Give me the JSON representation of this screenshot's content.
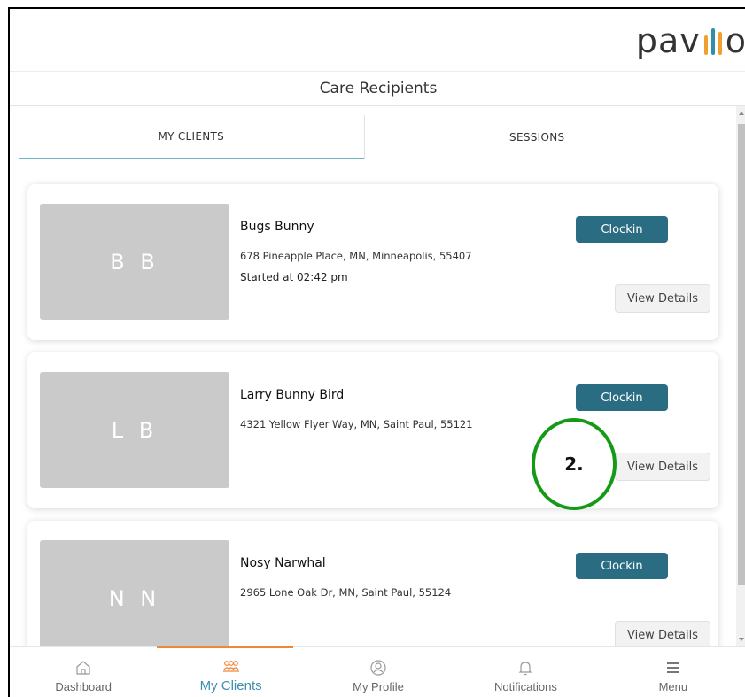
{
  "app": {
    "logo_text_left": "pav",
    "logo_text_right": "o"
  },
  "header": {
    "title": "Care Recipients"
  },
  "tabs": [
    {
      "label": "MY CLIENTS",
      "active": true
    },
    {
      "label": "SESSIONS",
      "active": false
    }
  ],
  "clients": [
    {
      "initials": "B B",
      "name": "Bugs Bunny",
      "address": "678 Pineapple Place, MN, Minneapolis, 55407",
      "started": "Started at 02:42 pm",
      "clockin_label": "Clockin",
      "details_label": "View Details"
    },
    {
      "initials": "L B",
      "name": "Larry Bunny Bird",
      "address": "4321 Yellow Flyer Way, MN, Saint Paul, 55121",
      "started": "",
      "clockin_label": "Clockin",
      "details_label": "View Details"
    },
    {
      "initials": "N N",
      "name": "Nosy Narwhal",
      "address": "2965 Lone Oak Dr, MN, Saint Paul, 55124",
      "started": "",
      "clockin_label": "Clockin",
      "details_label": "View Details"
    }
  ],
  "bottom_nav": [
    {
      "label": "Dashboard",
      "icon": "home-icon",
      "active": false
    },
    {
      "label": "My Clients",
      "icon": "clients-icon",
      "active": true
    },
    {
      "label": "My Profile",
      "icon": "profile-icon",
      "active": false
    },
    {
      "label": "Notifications",
      "icon": "bell-icon",
      "active": false
    },
    {
      "label": "Menu",
      "icon": "menu-icon",
      "active": false
    }
  ],
  "annotation": {
    "label": "2."
  },
  "colors": {
    "accent": "#2a6d82",
    "active_nav": "#3d8fb0",
    "indicator": "#f0883a",
    "annotation": "#159a16"
  }
}
